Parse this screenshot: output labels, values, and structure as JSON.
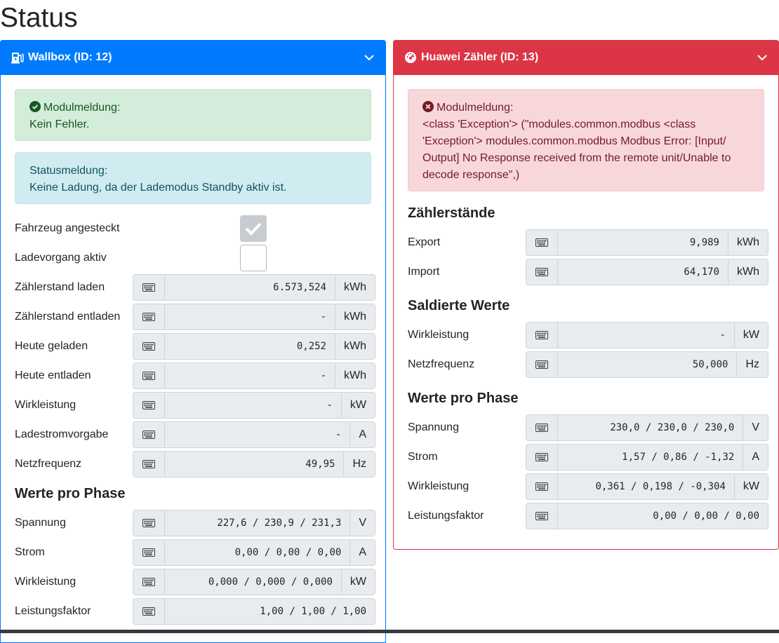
{
  "page": {
    "title": "Status"
  },
  "wallbox": {
    "header": "Wallbox (ID: 12)",
    "module_msg_label": "Modulmeldung:",
    "module_msg": "Kein Fehler.",
    "status_msg_label": "Statusmeldung:",
    "status_msg": "Keine Ladung, da der Lademodus Standby aktiv ist.",
    "plugged_label": "Fahrzeug angesteckt",
    "plugged": true,
    "charging_label": "Ladevorgang aktiv",
    "charging": false,
    "fields": [
      {
        "label": "Zählerstand laden",
        "value": "6.573,524",
        "unit": "kWh"
      },
      {
        "label": "Zählerstand entladen",
        "value": "-",
        "unit": "kWh"
      },
      {
        "label": "Heute geladen",
        "value": "0,252",
        "unit": "kWh"
      },
      {
        "label": "Heute entladen",
        "value": "-",
        "unit": "kWh"
      },
      {
        "label": "Wirkleistung",
        "value": "-",
        "unit": "kW"
      },
      {
        "label": "Ladestromvorgabe",
        "value": "-",
        "unit": "A"
      },
      {
        "label": "Netzfrequenz",
        "value": "49,95",
        "unit": "Hz"
      }
    ],
    "phase_title": "Werte pro Phase",
    "phase": [
      {
        "label": "Spannung",
        "value": "227,6 / 230,9 / 231,3",
        "unit": "V"
      },
      {
        "label": "Strom",
        "value": "0,00 / 0,00 / 0,00",
        "unit": "A"
      },
      {
        "label": "Wirkleistung",
        "value": "0,000 / 0,000 / 0,000",
        "unit": "kW"
      },
      {
        "label": "Leistungsfaktor",
        "value": "1,00 / 1,00 / 1,00",
        "unit": ""
      }
    ]
  },
  "meter": {
    "header": "Huawei Zähler (ID: 13)",
    "module_msg_label": "Modulmeldung:",
    "module_msg": "<class 'Exception'> (\"modules.common.modbus <class 'Exception'> modules.common.modbus Modbus Error: [Input/ Output] No Response received from the remote unit/Unable to decode response\",)",
    "counters_title": "Zählerstände",
    "counters": [
      {
        "label": "Export",
        "value": "9,989",
        "unit": "kWh"
      },
      {
        "label": "Import",
        "value": "64,170",
        "unit": "kWh"
      }
    ],
    "balanced_title": "Saldierte Werte",
    "balanced": [
      {
        "label": "Wirkleistung",
        "value": "-",
        "unit": "kW"
      },
      {
        "label": "Netzfrequenz",
        "value": "50,000",
        "unit": "Hz"
      }
    ],
    "phase_title": "Werte pro Phase",
    "phase": [
      {
        "label": "Spannung",
        "value": "230,0 / 230,0 / 230,0",
        "unit": "V"
      },
      {
        "label": "Strom",
        "value": "1,57 / 0,86 / -1,32",
        "unit": "A"
      },
      {
        "label": "Wirkleistung",
        "value": "0,361 / 0,198 / -0,304",
        "unit": "kW"
      },
      {
        "label": "Leistungsfaktor",
        "value": "0,00 / 0,00 / 0,00",
        "unit": ""
      }
    ]
  },
  "colors": {
    "primary": "#007bff",
    "danger": "#dc3545",
    "success_bg": "#d4edda",
    "info_bg": "#d1ecf1",
    "danger_bg": "#f8d7da"
  }
}
